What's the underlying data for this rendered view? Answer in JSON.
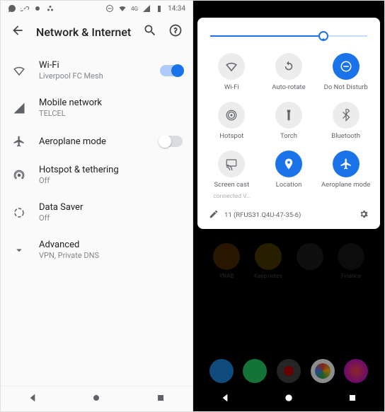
{
  "left": {
    "status": {
      "time": "14:34"
    },
    "header": {
      "title": "Network & Internet"
    },
    "items": {
      "wifi": {
        "label": "Wi-Fi",
        "sub": "Liverpool FC Mesh",
        "on": true
      },
      "mobile": {
        "label": "Mobile network",
        "sub": "TELCEL"
      },
      "airplane": {
        "label": "Aeroplane mode",
        "on": false
      },
      "hotspot": {
        "label": "Hotspot & tethering",
        "sub": "Off"
      },
      "datasaver": {
        "label": "Data Saver",
        "sub": "Off"
      },
      "advanced": {
        "label": "Advanced",
        "sub": "VPN, Private DNS"
      }
    }
  },
  "right": {
    "brightness_pct": 72,
    "tiles": {
      "wifi": {
        "label": "Wi-Fi",
        "on": false
      },
      "rotate": {
        "label": "Auto-rotate",
        "on": false
      },
      "dnd": {
        "label": "Do Not Disturb",
        "on": true
      },
      "hotspot": {
        "label": "Hotspot",
        "on": false
      },
      "torch": {
        "label": "Torch",
        "on": false
      },
      "bluetooth": {
        "label": "Bluetooth",
        "on": false
      },
      "cast": {
        "label": "Screen cast",
        "sub": "connected     V…",
        "on": false
      },
      "location": {
        "label": "Location",
        "on": true
      },
      "airplane": {
        "label": "Aeroplane mode",
        "on": true
      }
    },
    "build": "11 (RFUS31.Q4U-47-35-6)",
    "bg_app_labels": [
      "YNAB",
      "Keep notes",
      "",
      "Finance"
    ]
  },
  "colors": {
    "accent": "#1a73e8"
  }
}
